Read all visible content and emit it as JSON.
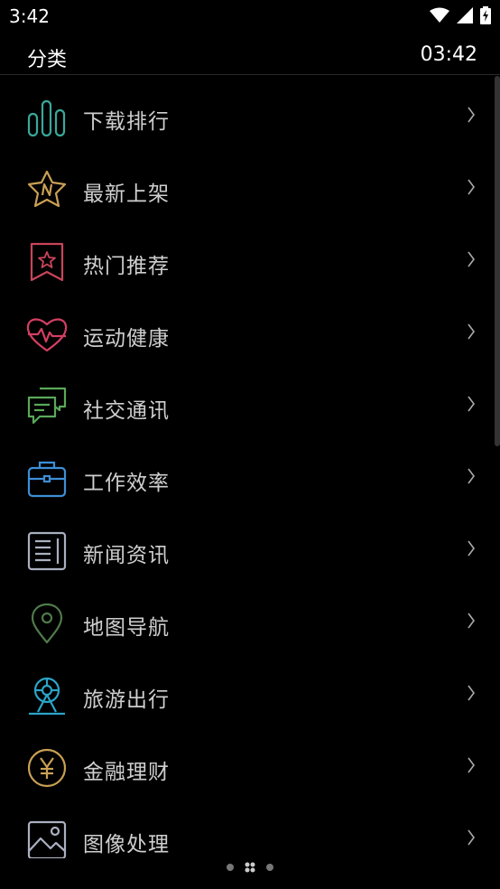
{
  "status_bar": {
    "time": "3:42"
  },
  "header": {
    "title": "分类",
    "clock": "03:42"
  },
  "items": [
    {
      "label": "下载排行",
      "icon": "bar-chart-icon",
      "color": "#3aa89a"
    },
    {
      "label": "最新上架",
      "icon": "star-new-icon",
      "color": "#c9a055"
    },
    {
      "label": "热门推荐",
      "icon": "bookmark-star-icon",
      "color": "#c8455a"
    },
    {
      "label": "运动健康",
      "icon": "heart-pulse-icon",
      "color": "#d43f62"
    },
    {
      "label": "社交通讯",
      "icon": "chat-bubbles-icon",
      "color": "#5aa85a"
    },
    {
      "label": "工作效率",
      "icon": "briefcase-icon",
      "color": "#3d8fd6"
    },
    {
      "label": "新闻资讯",
      "icon": "newspaper-icon",
      "color": "#aab0c0"
    },
    {
      "label": "地图导航",
      "icon": "map-pin-icon",
      "color": "#4f7a4a"
    },
    {
      "label": "旅游出行",
      "icon": "ferris-wheel-icon",
      "color": "#2aa5c8"
    },
    {
      "label": "金融理财",
      "icon": "yuan-coin-icon",
      "color": "#c9a055"
    },
    {
      "label": "图像处理",
      "icon": "image-icon",
      "color": "#aab0c0"
    }
  ]
}
